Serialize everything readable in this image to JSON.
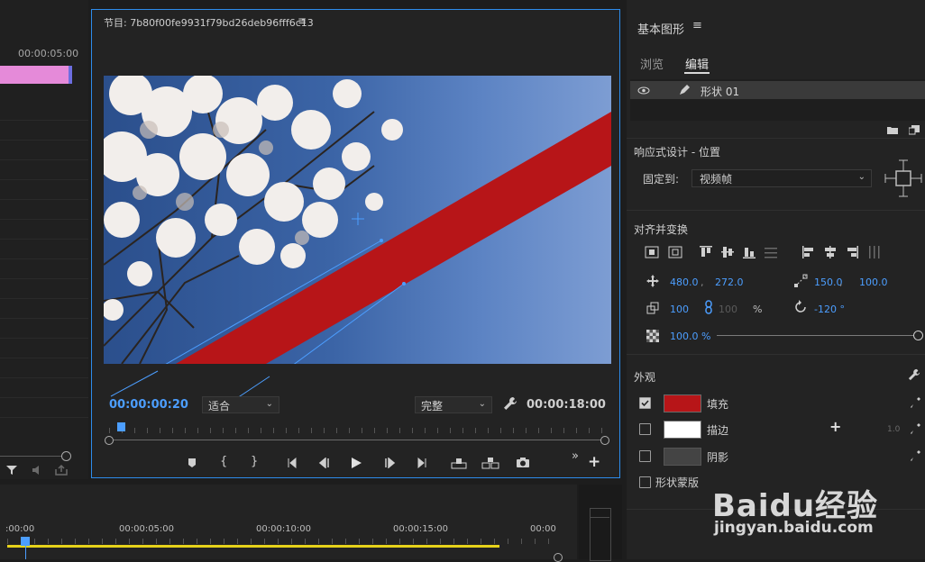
{
  "left_panel": {
    "timecode": "00:00:05:00"
  },
  "program": {
    "title": "节目: 7b80f00fe9931f79bd26deb96fff6c13",
    "menu_icon": "hamburger-icon",
    "current_time": "00:00:00:20",
    "fit_dropdown": "适合",
    "quality_dropdown": "完整",
    "duration": "00:00:18:00",
    "fill_color": "#b71518"
  },
  "timeline": {
    "labels": [
      ":00:00",
      "00:00:05:00",
      "00:00:10:00",
      "00:00:15:00",
      "00:00"
    ]
  },
  "essential_graphics": {
    "title": "基本图形",
    "tabs": [
      "浏览",
      "编辑"
    ],
    "active_tab": "编辑",
    "layer_name": "形状 01",
    "responsive_section": "响应式设计 - 位置",
    "pin_label": "固定到:",
    "pin_value": "视频帧",
    "align_section": "对齐并变换",
    "position_x": "480.0",
    "position_y": "272.0",
    "anchor_x": "150.0",
    "anchor_y": "100.0",
    "scale": "100",
    "scale_locked": "100",
    "scale_unit": "%",
    "rotation": "-120 °",
    "opacity": "100.0 %",
    "appearance_section": "外观",
    "fill_label": "填充",
    "stroke_label": "描边",
    "stroke_width": "1.0",
    "shadow_label": "阴影",
    "mask_label": "形状蒙版",
    "fill_swatch": "#b71518",
    "stroke_swatch": "#ffffff",
    "shadow_swatch": "#444444"
  },
  "watermark": {
    "brand": "Baidu经验",
    "url": "jingyan.baidu.com"
  }
}
